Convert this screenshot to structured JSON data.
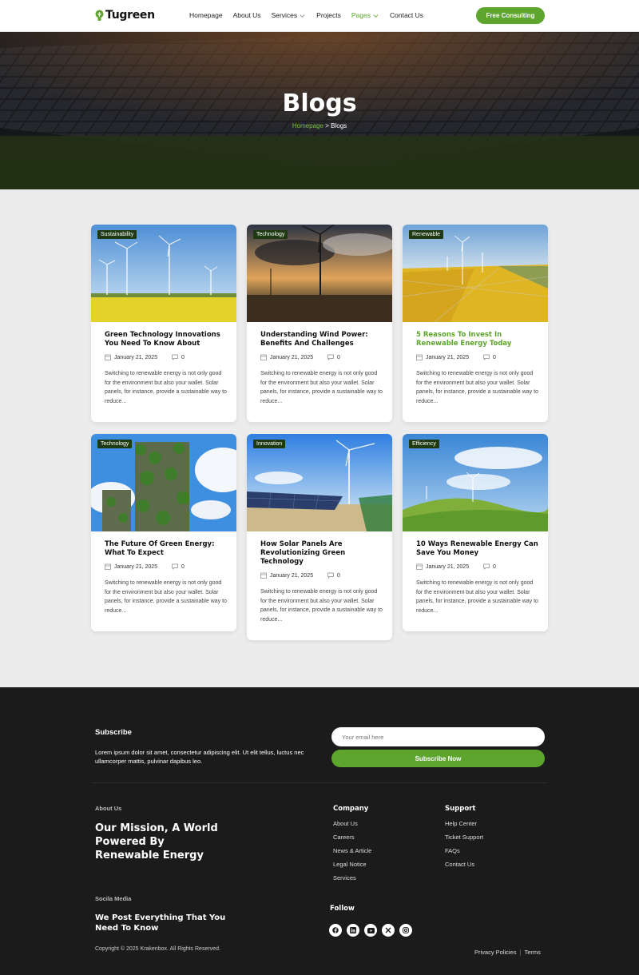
{
  "header": {
    "logo": "Tugreen",
    "nav": [
      {
        "label": "Homepage"
      },
      {
        "label": "About Us"
      },
      {
        "label": "Services"
      },
      {
        "label": "Projects"
      },
      {
        "label": "Pages"
      },
      {
        "label": "Contact Us"
      }
    ],
    "cta": "Free Consulting"
  },
  "hero": {
    "title": "Blogs",
    "crumb_home": "Homepage",
    "crumb_sep": ">",
    "crumb_current": "Blogs"
  },
  "posts": [
    {
      "tag": "Sustainability",
      "title": "Green Technology Innovations You Need To Know About",
      "date": "January 21, 2025",
      "comments": "0",
      "excerpt": "Switching to renewable energy is not only good for the environment but also your wallet. Solar panels, for instance, provide a sustainable way to reduce..."
    },
    {
      "tag": "Technology",
      "title": "Understanding Wind Power: Benefits And Challenges",
      "date": "January 21, 2025",
      "comments": "0",
      "excerpt": "Switching to renewable energy is not only good for the environment but also your wallet. Solar panels, for instance, provide a sustainable way to reduce..."
    },
    {
      "tag": "Renewable",
      "title": "5 Reasons To Invest In Renewable Energy Today",
      "date": "January 21, 2025",
      "comments": "0",
      "excerpt": "Switching to renewable energy is not only good for the environment but also your wallet. Solar panels, for instance, provide a sustainable way to reduce..."
    },
    {
      "tag": "Technology",
      "title": "The Future Of Green Energy: What To Expect",
      "date": "January 21, 2025",
      "comments": "0",
      "excerpt": "Switching to renewable energy is not only good for the environment but also your wallet. Solar panels, for instance, provide a sustainable way to reduce..."
    },
    {
      "tag": "Innovation",
      "title": "How Solar Panels Are Revolutionizing Green Technology",
      "date": "January 21, 2025",
      "comments": "0",
      "excerpt": "Switching to renewable energy is not only good for the environment but also your wallet. Solar panels, for instance, provide a sustainable way to reduce..."
    },
    {
      "tag": "Efficiency",
      "title": "10 Ways Renewable Energy Can Save You Money",
      "date": "January 21, 2025",
      "comments": "0",
      "excerpt": "Switching to renewable energy is not only good for the environment but also your wallet. Solar panels, for instance, provide a sustainable way to reduce..."
    }
  ],
  "footer": {
    "subscribe_title": "Subscribe",
    "subscribe_text": "Lorem ipsum dolor sit amet, consectetur adipiscing elit. Ut elit tellus, luctus nec ullamcorper mattis, pulvinar dapibus leo.",
    "email_placeholder": "Your email here",
    "subscribe_button": "Subscribe Now",
    "about_label": "About Us",
    "mission": "Our Mission, A World Powered By Renewable Energy",
    "social_label": "Socila Media",
    "social_heading": "We Post Everything That You Need To Know",
    "company_title": "Company",
    "company_links": [
      "About Us",
      "Careers",
      "News & Article",
      "Legal Notice",
      "Services"
    ],
    "support_title": "Support",
    "support_links": [
      "Help Center",
      "Ticket Support",
      "FAQs",
      "Contact Us"
    ],
    "follow_title": "Follow",
    "copyright": "Copyright © 2025 Krakenbox. All Rights Reserved.",
    "privacy": "Privacy Policies",
    "legal_sep": "|",
    "terms": "Terms"
  },
  "colors": {
    "accent": "#5da52c",
    "footer_bg": "#1b1b1b",
    "tag_bg": "#1f3a12"
  },
  "icons": [
    "lightbulb-logo-icon",
    "chevron-down-icon",
    "calendar-icon",
    "comment-icon",
    "facebook-icon",
    "linkedin-icon",
    "youtube-icon",
    "x-icon",
    "instagram-icon"
  ]
}
